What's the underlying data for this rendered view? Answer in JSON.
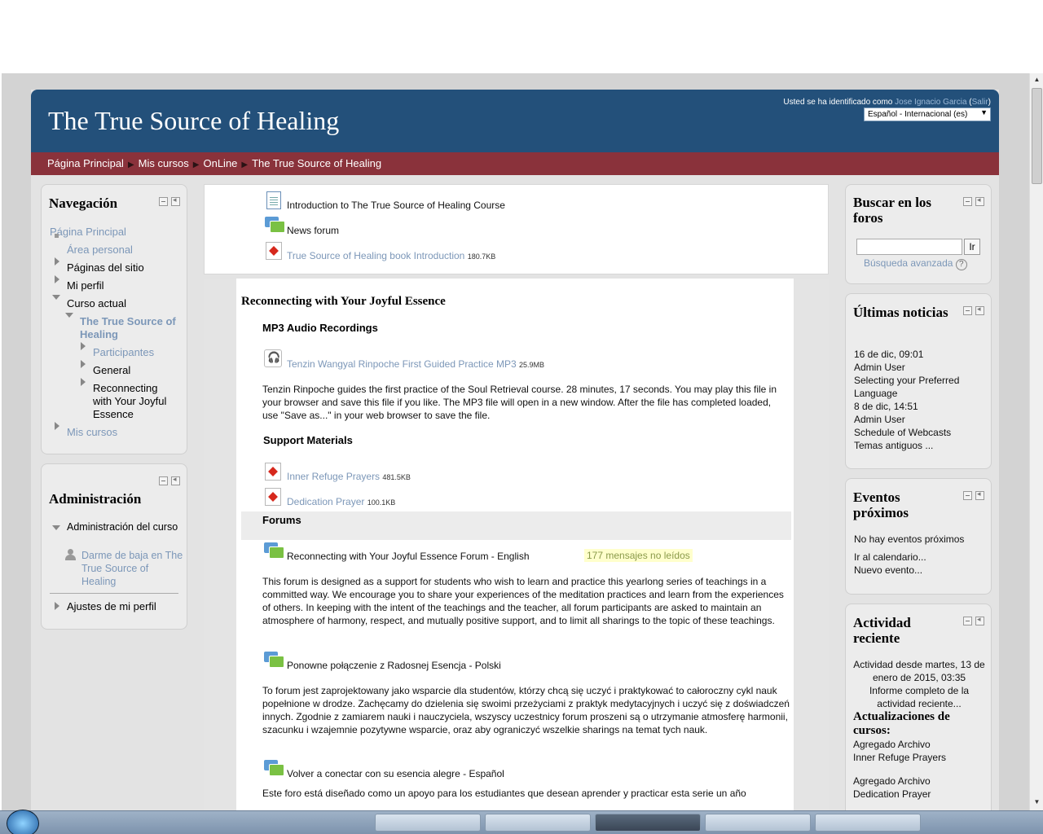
{
  "header": {
    "site_title": "The True Source of Healing",
    "login_prefix": "Usted se ha identificado como",
    "user_name": "Jose Ignacio Garcia",
    "logout_label": "Salir",
    "language": "Español - Internacional (es)"
  },
  "breadcrumb": [
    "Página Principal",
    "Mis cursos",
    "OnLine",
    "The True Source of Healing"
  ],
  "navigation": {
    "title": "Navegación",
    "items": {
      "home": "Página Principal",
      "personal": "Área personal",
      "site_pages": "Páginas del sitio",
      "profile": "Mi perfil",
      "current_course": "Curso actual",
      "course_name": "The True Source of Healing",
      "participants": "Participantes",
      "general": "General",
      "reconnecting": "Reconnecting with Your Joyful Essence",
      "my_courses": "Mis cursos"
    }
  },
  "admin": {
    "title": "Administración",
    "course_admin": "Administración del curso",
    "unenrol": "Darme de baja en The True Source of Healing",
    "profile_settings": "Ajustes de mi perfil"
  },
  "course_top": {
    "intro": "Introduction to The True Source of Healing Course",
    "news": "News forum",
    "book": "True Source of Healing book Introduction",
    "book_size": "180.7KB"
  },
  "section": {
    "title": "Reconnecting with Your Joyful Essence",
    "mp3_heading": "MP3 Audio Recordings",
    "mp3_link": "Tenzin Wangyal Rinpoche First Guided Practice MP3",
    "mp3_size": "25.9MB",
    "mp3_desc": "Tenzin Rinpoche guides the first practice of the Soul Retrieval course. 28 minutes, 17 seconds. You may play this file in your browser and save this file if you like. The MP3 file will open in a new window. After the file has completed loaded, use \"Save as...\" in your web browser to save the file.",
    "support_heading": "Support Materials",
    "prayers": "Inner Refuge Prayers",
    "prayers_size": "481.5KB",
    "dedication": "Dedication Prayer",
    "dedication_size": "100.1KB",
    "forums_heading": "Forums",
    "forum_en": "Reconnecting with Your Joyful Essence Forum - English",
    "unread": "177 mensajes no leídos",
    "forum_en_desc": "This forum is designed as a support for students who wish to learn and practice this yearlong series of teachings in a committed way. We encourage you to share your experiences of the meditation practices and learn from the experiences of others. In keeping with the intent of the teachings and the teacher, all forum participants are asked to maintain an atmosphere of harmony, respect, and mutually positive support, and to limit all sharings to the topic of these teachings.",
    "forum_pl": "Ponowne połączenie z Radosnej Esencja - Polski",
    "forum_pl_desc": "To forum jest zaprojektowany jako wsparcie dla studentów, którzy chcą się uczyć i praktykować to całoroczny cykl nauk popełnione w drodze. Zachęcamy do dzielenia się swoimi przeżyciami z praktyk medytacyjnych i uczyć się z doświadczeń innych. Zgodnie z zamiarem nauki i nauczyciela, wszyscy uczestnicy forum proszeni są o utrzymanie atmosferę harmonii, szacunku i wzajemnie pozytywne wsparcie, oraz aby ograniczyć wszelkie sharings na temat tych nauk.",
    "forum_es": "Volver a conectar con su esencia alegre - Español",
    "forum_es_desc": "Este foro está diseñado como un apoyo para los estudiantes que desean aprender y practicar esta serie un año"
  },
  "search_block": {
    "title": "Buscar en los foros",
    "go": "Ir",
    "advanced": "Búsqueda avanzada",
    "value": ""
  },
  "news_block": {
    "title": "Últimas noticias",
    "n1_date": "16 de dic, 09:01",
    "n1_author": "Admin User",
    "n1_link": "Selecting your Preferred Language",
    "n2_date": "8 de dic, 14:51",
    "n2_author": "Admin User",
    "n2_link": "Schedule of Webcasts",
    "older": "Temas antiguos ..."
  },
  "events_block": {
    "title": "Eventos próximos",
    "none": "No hay eventos próximos",
    "calendar": "Ir al calendario...",
    "new_event": "Nuevo evento..."
  },
  "activity_block": {
    "title": "Actividad reciente",
    "since": "Actividad desde martes, 13 de enero de 2015, 03:35",
    "full_report": "Informe completo de la actividad reciente...",
    "updates_heading": "Actualizaciones de cursos:",
    "a1_label": "Agregado Archivo",
    "a1_link": "Inner Refuge Prayers",
    "a2_label": "Agregado Archivo",
    "a2_link": "Dedication Prayer"
  },
  "colors": {
    "header_bg": "#23507a",
    "navbar_bg": "#8a323b",
    "link": "#7c97b8"
  }
}
